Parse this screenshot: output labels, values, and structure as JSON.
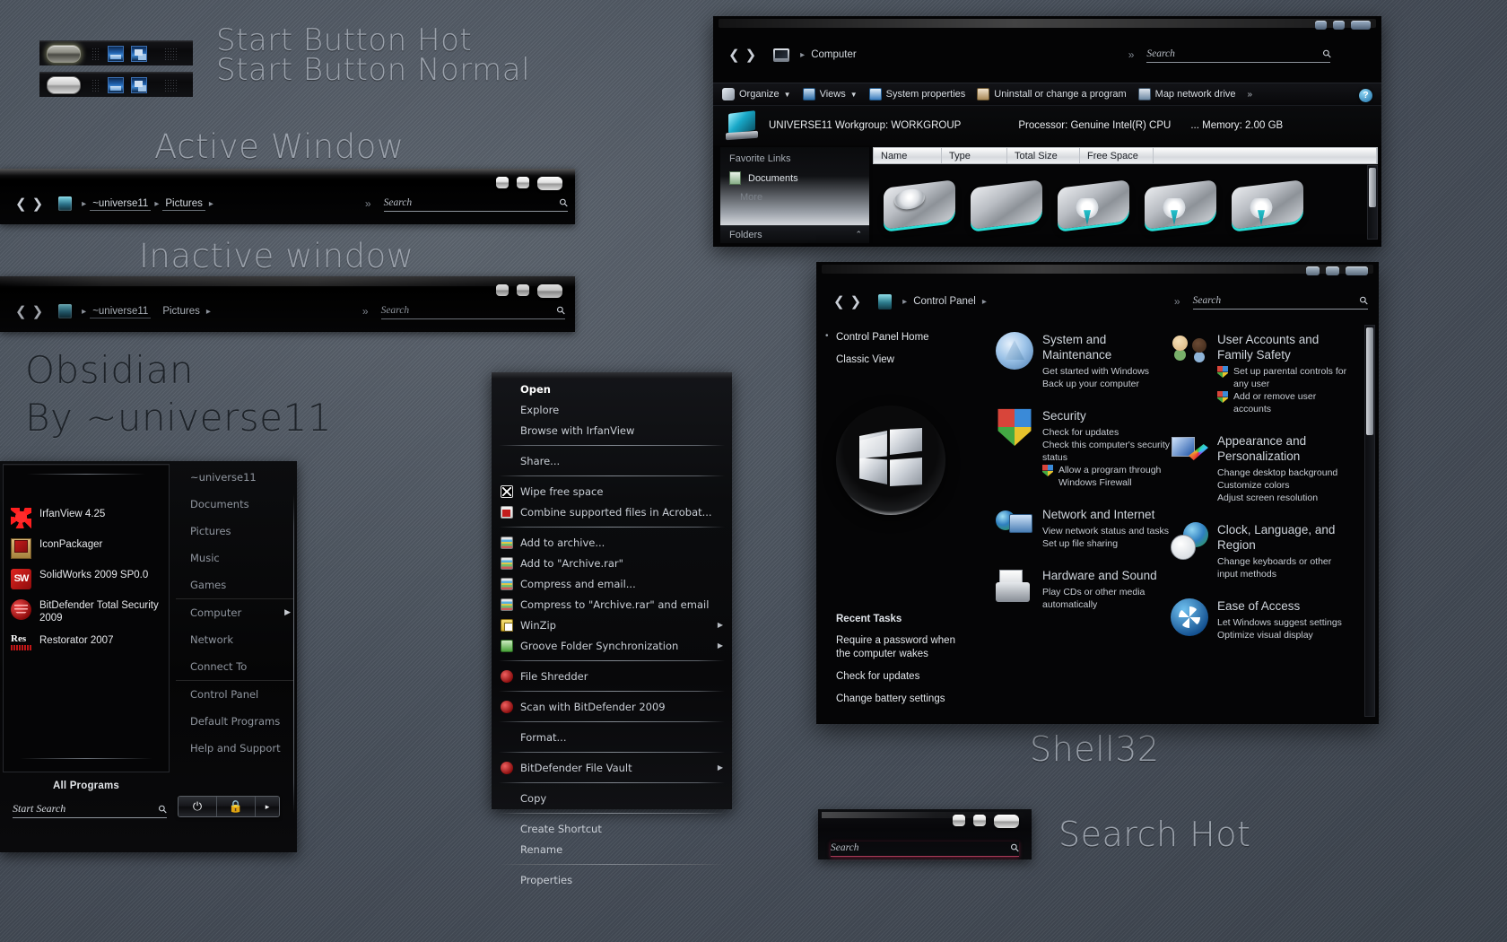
{
  "annotations": {
    "start_hot": "Start Button Hot",
    "start_normal": "Start Button Normal",
    "active_window": "Active Window",
    "inactive_window": "Inactive window",
    "theme_name": "Obsidian",
    "theme_author": "By ~universe11",
    "shell32": "Shell32",
    "search_hot": "Search Hot"
  },
  "explorer_sample": {
    "crumb_user": "~universe11",
    "crumb_folder": "Pictures",
    "search_placeholder": "Search",
    "icons": {
      "back": "back-arrow-icon",
      "forward": "forward-arrow-icon",
      "mag": "magnifier-icon"
    }
  },
  "start_menu": {
    "programs": [
      {
        "label": "IrfanView 4.25",
        "icon": "irfanview-icon"
      },
      {
        "label": "IconPackager",
        "icon": "iconpackager-icon"
      },
      {
        "label": "SolidWorks 2009 SP0.0",
        "icon": "solidworks-icon"
      },
      {
        "label": "BitDefender Total Security 2009",
        "icon": "bitdefender-icon"
      },
      {
        "label": "Restorator 2007",
        "icon": "restorator-icon"
      }
    ],
    "places": [
      {
        "label": "~universe11",
        "sep": false,
        "arrow": ""
      },
      {
        "label": "Documents",
        "sep": false,
        "arrow": ""
      },
      {
        "label": "Pictures",
        "sep": false,
        "arrow": ""
      },
      {
        "label": "Music",
        "sep": false,
        "arrow": ""
      },
      {
        "label": "Games",
        "sep": false,
        "arrow": ""
      },
      {
        "label": "Computer",
        "sep": true,
        "arrow": "▶"
      },
      {
        "label": "Network",
        "sep": false,
        "arrow": ""
      },
      {
        "label": "Connect To",
        "sep": false,
        "arrow": ""
      },
      {
        "label": "Control Panel",
        "sep": true,
        "arrow": ""
      },
      {
        "label": "Default Programs",
        "sep": false,
        "arrow": ""
      },
      {
        "label": "Help and Support",
        "sep": false,
        "arrow": ""
      }
    ],
    "all_programs": "All Programs",
    "search_placeholder": "Start Search",
    "power_buttons": [
      {
        "name": "power-button",
        "glyph": "⏻"
      },
      {
        "name": "lock-button",
        "glyph": "ὑ2"
      },
      {
        "name": "shutdown-options-button",
        "glyph": "▶"
      }
    ]
  },
  "context_menu": {
    "items": [
      {
        "label": "Open",
        "icon": "",
        "bold": true,
        "sep_after": false,
        "sub": ""
      },
      {
        "label": "Explore",
        "icon": "",
        "bold": false,
        "sep_after": false,
        "sub": ""
      },
      {
        "label": "Browse with IrfanView",
        "icon": "",
        "bold": false,
        "sep_after": true,
        "sub": ""
      },
      {
        "label": "Share...",
        "icon": "",
        "bold": false,
        "sep_after": true,
        "sub": ""
      },
      {
        "label": "Wipe free space",
        "icon": "wipe",
        "bold": false,
        "sep_after": false,
        "sub": ""
      },
      {
        "label": "Combine supported files in Acrobat...",
        "icon": "acro",
        "bold": false,
        "sep_after": true,
        "sub": ""
      },
      {
        "label": "Add to archive...",
        "icon": "rar",
        "bold": false,
        "sep_after": false,
        "sub": ""
      },
      {
        "label": "Add to \"Archive.rar\"",
        "icon": "rar",
        "bold": false,
        "sep_after": false,
        "sub": ""
      },
      {
        "label": "Compress and email...",
        "icon": "rar",
        "bold": false,
        "sep_after": false,
        "sub": ""
      },
      {
        "label": "Compress to \"Archive.rar\" and email",
        "icon": "rar",
        "bold": false,
        "sep_after": false,
        "sub": ""
      },
      {
        "label": "WinZip",
        "icon": "winzip",
        "bold": false,
        "sep_after": false,
        "sub": "▶"
      },
      {
        "label": "Groove Folder Synchronization",
        "icon": "groove",
        "bold": false,
        "sep_after": true,
        "sub": "▶"
      },
      {
        "label": "File Shredder",
        "icon": "bdr",
        "bold": false,
        "sep_after": true,
        "sub": ""
      },
      {
        "label": "Scan with BitDefender 2009",
        "icon": "bdr",
        "bold": false,
        "sep_after": true,
        "sub": ""
      },
      {
        "label": "Format...",
        "icon": "",
        "bold": false,
        "sep_after": true,
        "sub": ""
      },
      {
        "label": "BitDefender File Vault",
        "icon": "bdr",
        "bold": false,
        "sep_after": true,
        "sub": "▶"
      },
      {
        "label": "Copy",
        "icon": "",
        "bold": false,
        "sep_after": true,
        "sub": ""
      },
      {
        "label": "Create Shortcut",
        "icon": "",
        "bold": false,
        "sep_after": false,
        "sub": ""
      },
      {
        "label": "Rename",
        "icon": "",
        "bold": false,
        "sep_after": true,
        "sub": ""
      },
      {
        "label": "Properties",
        "icon": "",
        "bold": false,
        "sep_after": false,
        "sub": ""
      }
    ]
  },
  "computer_window": {
    "breadcrumb": "Computer",
    "search_placeholder": "Search",
    "toolbar": [
      {
        "label": "Organize",
        "icon": "org",
        "caret": "▼"
      },
      {
        "label": "Views",
        "icon": "views",
        "caret": "▼"
      },
      {
        "label": "System properties",
        "icon": "sysprop",
        "caret": ""
      },
      {
        "label": "Uninstall or change a program",
        "icon": "uninst",
        "caret": ""
      },
      {
        "label": "Map network drive",
        "icon": "mapnet",
        "caret": ""
      }
    ],
    "toolbar_overflow": "»",
    "help_glyph": "?",
    "info": {
      "computer_name": "UNIVERSE11",
      "workgroup": "Workgroup: WORKGROUP",
      "processor": "Processor:  Genuine Intel(R) CPU",
      "memory": "... Memory: 2.00 GB"
    },
    "sidebar": {
      "head": "Favorite Links",
      "items": [
        {
          "label": "Documents",
          "icon": "documents-icon"
        }
      ],
      "more": "More",
      "folders": "Folders",
      "folders_caret": "⌃"
    },
    "columns": [
      "Name",
      "Type",
      "Total Size",
      "Free Space"
    ],
    "drives": [
      "hard-disk-drive",
      "hard-disk-drive-plain",
      "dvd-drive",
      "dvd-drive",
      "dvd-drive"
    ]
  },
  "control_panel": {
    "breadcrumb": "Control Panel",
    "search_placeholder": "Search",
    "sidenav": [
      {
        "label": "Control Panel Home",
        "dotted": true
      },
      {
        "label": "Classic View",
        "dotted": false
      }
    ],
    "recent_tasks": {
      "head": "Recent Tasks",
      "items": [
        "Require a password when the computer wakes",
        "Check for updates",
        "Change battery settings"
      ]
    },
    "categories_col1": [
      {
        "title": "System and Maintenance",
        "icon": "ci-sysmaint",
        "links": [
          {
            "text": "Get started with Windows",
            "shield": false
          },
          {
            "text": "Back up your computer",
            "shield": false
          }
        ]
      },
      {
        "title": "Security",
        "icon": "ci-security",
        "links": [
          {
            "text": "Check for updates",
            "shield": false
          },
          {
            "text": "Check this computer's security status",
            "shield": false
          },
          {
            "text": "Allow a program through Windows Firewall",
            "shield": true
          }
        ]
      },
      {
        "title": "Network and Internet",
        "icon": "ci-network",
        "links": [
          {
            "text": "View network status and tasks",
            "shield": false
          },
          {
            "text": "Set up file sharing",
            "shield": false
          }
        ]
      },
      {
        "title": "Hardware and Sound",
        "icon": "ci-hardware",
        "links": [
          {
            "text": "Play CDs or other media automatically",
            "shield": false
          }
        ]
      }
    ],
    "categories_col2": [
      {
        "title": "User Accounts and Family Safety",
        "icon": "ci-useracct",
        "links": [
          {
            "text": "Set up parental controls for any user",
            "shield": true
          },
          {
            "text": "Add or remove user accounts",
            "shield": true
          }
        ]
      },
      {
        "title": "Appearance and Personalization",
        "icon": "ci-appearance",
        "links": [
          {
            "text": "Change desktop background",
            "shield": false
          },
          {
            "text": "Customize colors",
            "shield": false
          },
          {
            "text": "Adjust screen resolution",
            "shield": false
          }
        ]
      },
      {
        "title": "Clock, Language, and Region",
        "icon": "ci-clock",
        "links": [
          {
            "text": "Change keyboards or other input methods",
            "shield": false
          }
        ]
      },
      {
        "title": "Ease of Access",
        "icon": "ci-ease",
        "links": [
          {
            "text": "Let Windows suggest settings",
            "shield": false
          },
          {
            "text": "Optimize visual display",
            "shield": false
          }
        ]
      }
    ]
  },
  "search_hot_sample": {
    "placeholder": "Search",
    "accent": "#a53a56"
  },
  "colors": {
    "desktop": "#4d5560",
    "window_bg": "#050506",
    "label_text": "#9aa1ab",
    "accent_cyan": "#26e0d8",
    "accent_red": "#a53a56"
  }
}
